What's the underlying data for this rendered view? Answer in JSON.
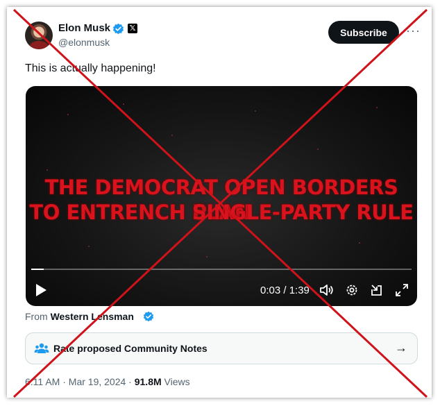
{
  "author": {
    "name": "Elon Musk",
    "handle": "@elonmusk",
    "badge_letter": "𝕏"
  },
  "header": {
    "subscribe_label": "Subscribe",
    "more_label": "···"
  },
  "tweet": {
    "text": "This is actually happening!"
  },
  "video": {
    "title_line1": "THE DEMOCRAT OPEN BORDERS PLAN",
    "title_line2": "TO ENTRENCH SINGLE-PARTY RULE",
    "time": "0:03 / 1:39",
    "progress": 0.033
  },
  "source": {
    "prefix": "From",
    "name": "Western Lensman"
  },
  "community_notes": {
    "label": "Rate proposed Community Notes",
    "arrow": "→"
  },
  "meta": {
    "time": "6:11 AM",
    "date": "Mar 19, 2024",
    "views_count": "91.8M",
    "views_label": "Views"
  },
  "colors": {
    "overlay_cross": "#d0121a",
    "verified": "#1d9bf0",
    "video_text": "#d8131d"
  }
}
